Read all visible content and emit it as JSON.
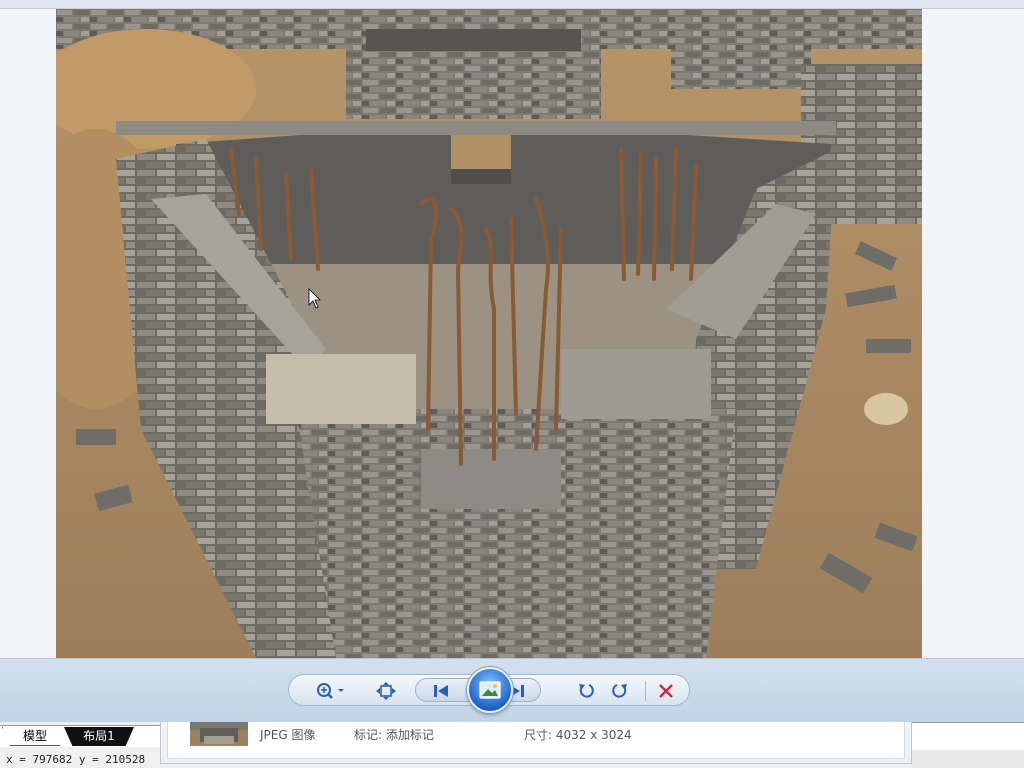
{
  "viewer": {
    "photo_alt": "",
    "toolbar": {
      "zoom": "zoom-in-icon",
      "actual_size": "fit-window-icon",
      "previous": "skip-previous-icon",
      "slideshow": "slideshow-icon",
      "next": "skip-next-icon",
      "rotate_ccw": "rotate-left-icon",
      "rotate_cw": "rotate-right-icon",
      "delete": "delete-icon"
    }
  },
  "info_panel": {
    "file_type": "JPEG 图像",
    "tag_label": "标记:",
    "tag_action": "添加标记",
    "size_label": "尺寸:",
    "size_value": "4032 x 3024"
  },
  "cad": {
    "tabs": [
      {
        "label": "模型"
      },
      {
        "label": "布局1"
      }
    ],
    "coordinates": "x = 797682  y = 210528"
  },
  "colors": {
    "toolbar_bg": "#c1d3e6",
    "slideshow_button": "#1f63c8",
    "delete_icon": "#d9262e",
    "accent_blue": "#2a5fb5"
  }
}
